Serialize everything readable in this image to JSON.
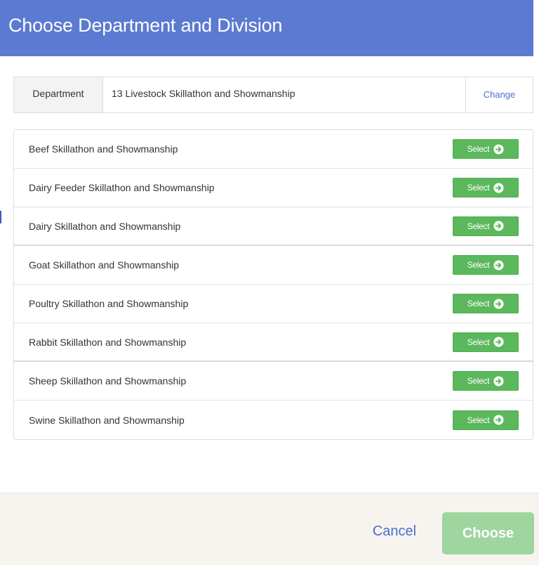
{
  "dialog": {
    "title": "Choose Department and Division"
  },
  "department": {
    "label": "Department",
    "value": "13 Livestock Skillathon and Showmanship",
    "change_label": "Change"
  },
  "divisions": [
    {
      "name": "Beef Skillathon and Showmanship",
      "button": "Select"
    },
    {
      "name": "Dairy Feeder Skillathon and Showmanship",
      "button": "Select"
    },
    {
      "name": "Dairy Skillathon and Showmanship",
      "button": "Select"
    },
    {
      "name": "Goat Skillathon and Showmanship",
      "button": "Select"
    },
    {
      "name": "Poultry Skillathon and Showmanship",
      "button": "Select"
    },
    {
      "name": "Rabbit Skillathon and Showmanship",
      "button": "Select"
    },
    {
      "name": "Sheep Skillathon and Showmanship",
      "button": "Select"
    },
    {
      "name": "Swine Skillathon and Showmanship",
      "button": "Select"
    }
  ],
  "footer": {
    "cancel_label": "Cancel",
    "choose_label": "Choose"
  },
  "colors": {
    "header": "#5b7ad1",
    "select_button": "#5cb85c",
    "choose_button_disabled": "#9fd59f",
    "link": "#4a70c9",
    "footer_bg": "#f7f3ef"
  },
  "icons": {
    "select_button_icon": "arrow-right-circle-icon"
  }
}
